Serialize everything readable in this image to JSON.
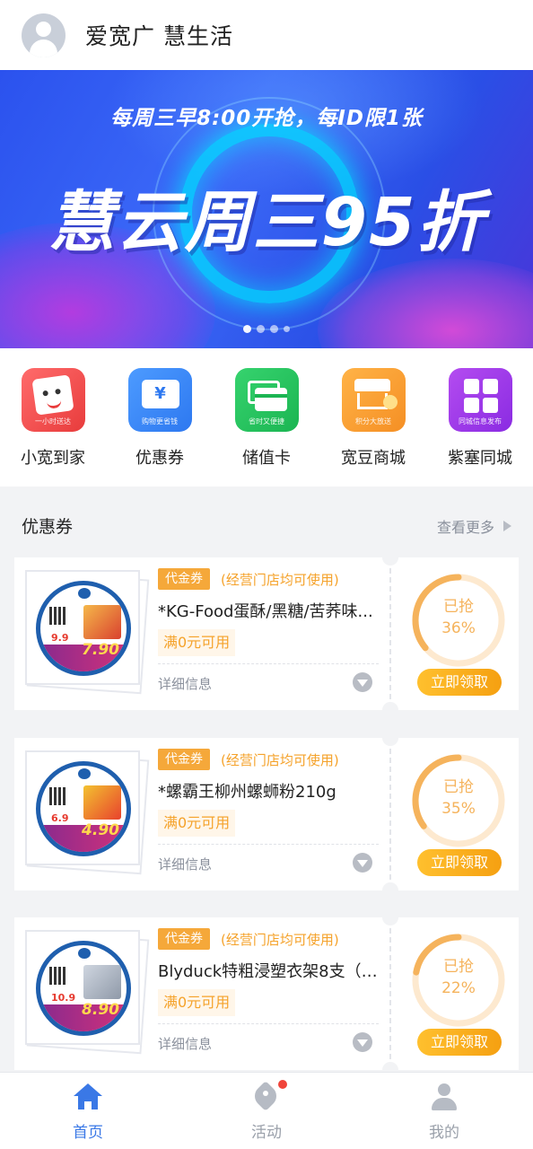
{
  "header": {
    "title": "爱宽广 慧生活"
  },
  "banner": {
    "subtitle": "每周三早8:00开抢，每ID限1张",
    "headline": "慧云周三95折",
    "slide_count": 4,
    "active_slide": 1
  },
  "nav": [
    {
      "label": "小宽到家",
      "caption": "一小时送达",
      "icon": "shopping-bag-face-icon",
      "color": "#e83c3c"
    },
    {
      "label": "优惠券",
      "caption": "购物更省钱",
      "icon": "yen-ticket-icon",
      "color": "#2d78f0"
    },
    {
      "label": "储值卡",
      "caption": "省时又便捷",
      "icon": "card-icon",
      "color": "#1bb552"
    },
    {
      "label": "宽豆商城",
      "caption": "积分大放送",
      "icon": "shop-coin-icon",
      "color": "#f58f24"
    },
    {
      "label": "紫塞同城",
      "caption": "同城信息发布",
      "icon": "grid-icon",
      "color": "#8a2be2"
    }
  ],
  "coupons_section": {
    "title": "优惠券",
    "more_label": "查看更多"
  },
  "coupons": [
    {
      "tag": "代金券",
      "note": "(经营门店均可使用)",
      "title": "*KG-Food蛋酥/黑糖/苦荞味...",
      "condition": "满0元可用",
      "detail_label": "详细信息",
      "grabbed_label": "已抢",
      "grabbed_percent": "36%",
      "grabbed_fraction": 0.36,
      "button": "立即领取",
      "thumb_price": "7.90",
      "thumb_promo": "9.9"
    },
    {
      "tag": "代金券",
      "note": "(经营门店均可使用)",
      "title": "*螺霸王柳州螺蛳粉210g",
      "condition": "满0元可用",
      "detail_label": "详细信息",
      "grabbed_label": "已抢",
      "grabbed_percent": "35%",
      "grabbed_fraction": 0.35,
      "button": "立即领取",
      "thumb_price": "4.90",
      "thumb_promo": "6.9"
    },
    {
      "tag": "代金券",
      "note": "(经营门店均可使用)",
      "title": "Blyduck特粗浸塑衣架8支（4...",
      "condition": "满0元可用",
      "detail_label": "详细信息",
      "grabbed_label": "已抢",
      "grabbed_percent": "22%",
      "grabbed_fraction": 0.22,
      "button": "立即领取",
      "thumb_price": "8.90",
      "thumb_promo": "10.9"
    }
  ],
  "tabbar": [
    {
      "label": "首页",
      "icon": "home-icon",
      "active": true
    },
    {
      "label": "活动",
      "icon": "tag-icon",
      "active": false,
      "badge": true
    },
    {
      "label": "我的",
      "icon": "user-icon",
      "active": false
    }
  ],
  "colors": {
    "accent": "#3a78e6",
    "coupon_orange": "#f5a83a",
    "button": "#f5a011"
  }
}
